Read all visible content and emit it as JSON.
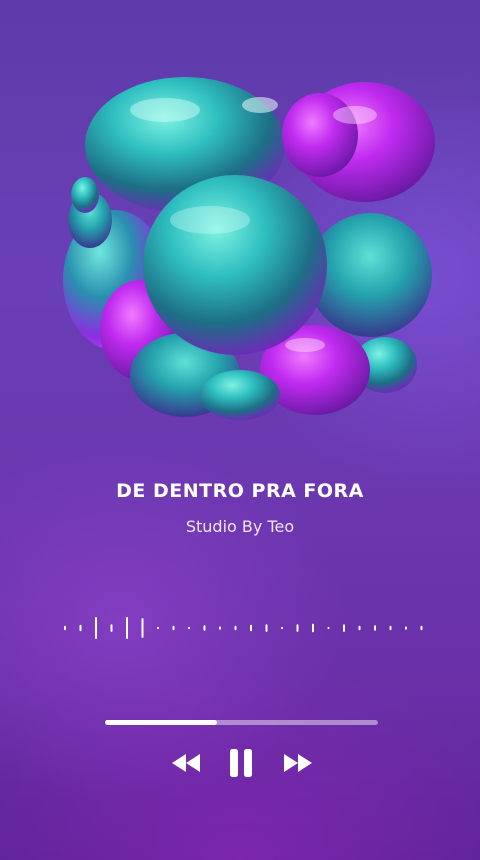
{
  "track": {
    "title": "DE DENTRO PRA FORA",
    "artist": "Studio By Teo"
  },
  "playback": {
    "state": "paused",
    "progress": 0.41
  },
  "waveform": {
    "levels": [
      0.2,
      0.3,
      1.0,
      0.35,
      1.0,
      0.9,
      0.1,
      0.2,
      0.1,
      0.25,
      0.15,
      0.2,
      0.3,
      0.35,
      0.1,
      0.35,
      0.4,
      0.1,
      0.35,
      0.2,
      0.25,
      0.2,
      0.15,
      0.2,
      0.25
    ]
  },
  "controls": {
    "rewind_icon": "rewind-icon",
    "pause_icon": "pause-icon",
    "forward_icon": "fast-forward-icon"
  },
  "colors": {
    "accent": "#ffffff",
    "background_top": "#5d3ba8",
    "background_bottom": "#5a2396",
    "blob_teal": "#2fc6c4",
    "blob_magenta": "#c02bf0"
  }
}
